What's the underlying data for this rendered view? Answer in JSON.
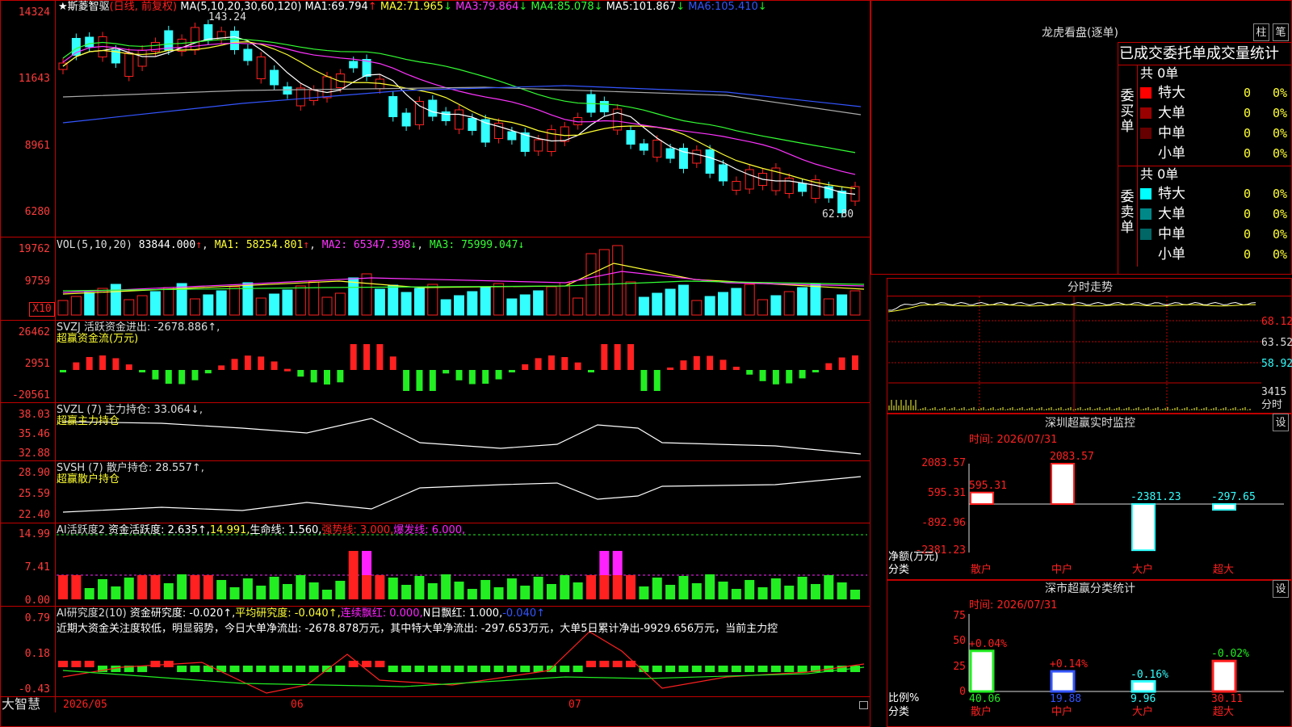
{
  "colors": {
    "up": "#ff2020",
    "down": "#33ffff",
    "ma1": "#ffffff",
    "ma2": "#ffff33",
    "ma3": "#ff33ff",
    "ma4": "#33ff33",
    "ma5": "#aaaaaa",
    "ma6": "#3355ff",
    "green": "#22ee22",
    "magenta": "#ff22ff"
  },
  "main": {
    "stock_name": "斯菱智驱",
    "mode": "(日线, 前复权)",
    "ma_params": "MA(5,10,20,30,60,120)",
    "ma_values": [
      {
        "label": "MA1:",
        "value": "69.794",
        "dir": "↑"
      },
      {
        "label": "MA2:",
        "value": "71.965",
        "dir": "↓"
      },
      {
        "label": "MA3:",
        "value": "79.864",
        "dir": "↓"
      },
      {
        "label": "MA4:",
        "value": "85.078",
        "dir": "↓"
      },
      {
        "label": "MA5:",
        "value": "101.867",
        "dir": "↓"
      },
      {
        "label": "MA6:",
        "value": "105.410",
        "dir": "↓"
      }
    ],
    "y_ticks": [
      "14324",
      "11643",
      "8961",
      "6280"
    ],
    "high_label": "143.24",
    "low_label": "62.80"
  },
  "vol": {
    "title": "VOL(5,10,20)",
    "value": "83844.000",
    "ma1": "58254.801",
    "ma2": "65347.398",
    "ma3": "75999.047",
    "y_ticks": [
      "19762",
      "9759"
    ],
    "unit": "X10"
  },
  "svzj": {
    "line1": "SVZJ  活跃资金进出: -2678.886↑,",
    "line2": "超赢资金流(万元)",
    "y_ticks": [
      "26462",
      "2951",
      "-20561"
    ]
  },
  "svzl": {
    "line1": "SVZL (7) 主力持仓: 33.064↓,",
    "line2": "超赢主力持仓",
    "y_ticks": [
      "38.03",
      "35.46",
      "32.88"
    ]
  },
  "svsh": {
    "line1": "SVSH (7) 散户持仓: 28.557↑,",
    "line2": "超赢散户持仓",
    "y_ticks": [
      "28.90",
      "25.59",
      "22.40"
    ]
  },
  "ai1": {
    "name": "AI活跃度2",
    "a": "资金活跃度: 2.635↑,",
    "b": "14.991,",
    "c": "生命线: 1.560,",
    "d": "强势线: 3.000,",
    "e": "爆发线: 6.000,",
    "y_ticks": [
      "14.99",
      "7.41",
      "0.00"
    ]
  },
  "ai2": {
    "name": "AI研究度2(10)",
    "a": "资金研究度: -0.020↑,",
    "b": "平均研究度: -0.040↑,",
    "c": "连续飘红: 0.000,",
    "d": "N日飘红: 1.000,",
    "e": "-0.040↑",
    "summary": "近期大资金关注度较低，明显弱势，今日大单净流出: -2678.878万元，其中特大单净流出: -297.653万元，大单5日累计净出-9929.656万元，当前主力控",
    "y_ticks": [
      "0.79",
      "0.18",
      "-0.43"
    ]
  },
  "x_axis": {
    "app": "大智慧",
    "labels": [
      "2026/05",
      "06",
      "07"
    ]
  },
  "dragon": {
    "title": "龙虎看盘(逐单)",
    "btn1": "柱",
    "btn2": "笔",
    "header": "已成交委托单成交量统计",
    "buy": {
      "side": "委买单",
      "total": "共 0单",
      "rows": [
        {
          "name": "特大",
          "n": "0",
          "pct": "0%",
          "color": "#ff0000"
        },
        {
          "name": "大单",
          "n": "0",
          "pct": "0%",
          "color": "#990000"
        },
        {
          "name": "中单",
          "n": "0",
          "pct": "0%",
          "color": "#660000"
        },
        {
          "name": "小单",
          "n": "0",
          "pct": "0%",
          "color": ""
        }
      ]
    },
    "sell": {
      "side": "委卖单",
      "total": "共 0单",
      "rows": [
        {
          "name": "特大",
          "n": "0",
          "pct": "0%",
          "color": "#00ffff"
        },
        {
          "name": "大单",
          "n": "0",
          "pct": "0%",
          "color": "#008888"
        },
        {
          "name": "中单",
          "n": "0",
          "pct": "0%",
          "color": "#006666"
        },
        {
          "name": "小单",
          "n": "0",
          "pct": "0%",
          "color": ""
        }
      ]
    }
  },
  "intraday": {
    "title": "分时走势",
    "y_ticks": [
      "68.12",
      "63.52",
      "58.92"
    ],
    "vol_tick": "3415",
    "vol_label": "分时"
  },
  "monitor": {
    "title": "深圳超赢实时监控",
    "btn": "设",
    "time": "时间: 2026/07/31",
    "y_ticks": [
      "2083.57",
      "595.31",
      "-892.96",
      "-2381.23"
    ],
    "y_label": "净额(万元)",
    "x_label": "分类",
    "bars": [
      {
        "cat": "散户",
        "value": 595.31,
        "label": "595.31"
      },
      {
        "cat": "中户",
        "value": 2083.57,
        "label": "2083.57"
      },
      {
        "cat": "大户",
        "value": -2381.23,
        "label": "-2381.23"
      },
      {
        "cat": "超大",
        "value": -297.65,
        "label": "-297.65"
      }
    ]
  },
  "classify": {
    "title": "深市超赢分类统计",
    "btn": "设",
    "time": "时间: 2026/07/31",
    "y_ticks": [
      "75",
      "50",
      "25",
      "0"
    ],
    "y_label": "比例%",
    "x_label": "分类",
    "bars": [
      {
        "cat": "散户",
        "value": 40.06,
        "label": "40.06",
        "change": "+0.04%"
      },
      {
        "cat": "中户",
        "value": 19.88,
        "label": "19.88",
        "change": "+0.14%"
      },
      {
        "cat": "大户",
        "value": 9.96,
        "label": "9.96",
        "change": "-0.16%"
      },
      {
        "cat": "超大",
        "value": 30.11,
        "label": "30.11",
        "change": "-0.02%"
      }
    ]
  },
  "chart_data": [
    {
      "type": "candlestick",
      "title": "斯菱智驱 (日线, 前复权)",
      "ylim": [
        62.8,
        143.24
      ],
      "high": 143.24,
      "low": 62.8,
      "series": [
        {
          "name": "MA1",
          "last": 69.794
        },
        {
          "name": "MA2",
          "last": 71.965
        },
        {
          "name": "MA3",
          "last": 79.864
        },
        {
          "name": "MA4",
          "last": 85.078
        },
        {
          "name": "MA5",
          "last": 101.867
        },
        {
          "name": "MA6",
          "last": 105.41
        }
      ]
    },
    {
      "type": "bar",
      "title": "深圳超赢实时监控",
      "categories": [
        "散户",
        "中户",
        "大户",
        "超大"
      ],
      "values": [
        595.31,
        2083.57,
        -2381.23,
        -297.65
      ],
      "ylabel": "净额(万元)",
      "ylim": [
        -2381.23,
        2083.57
      ]
    },
    {
      "type": "bar",
      "title": "深市超赢分类统计",
      "categories": [
        "散户",
        "中户",
        "大户",
        "超大"
      ],
      "values": [
        40.06,
        19.88,
        9.96,
        30.11
      ],
      "ylabel": "比例%",
      "ylim": [
        0,
        75
      ]
    }
  ]
}
